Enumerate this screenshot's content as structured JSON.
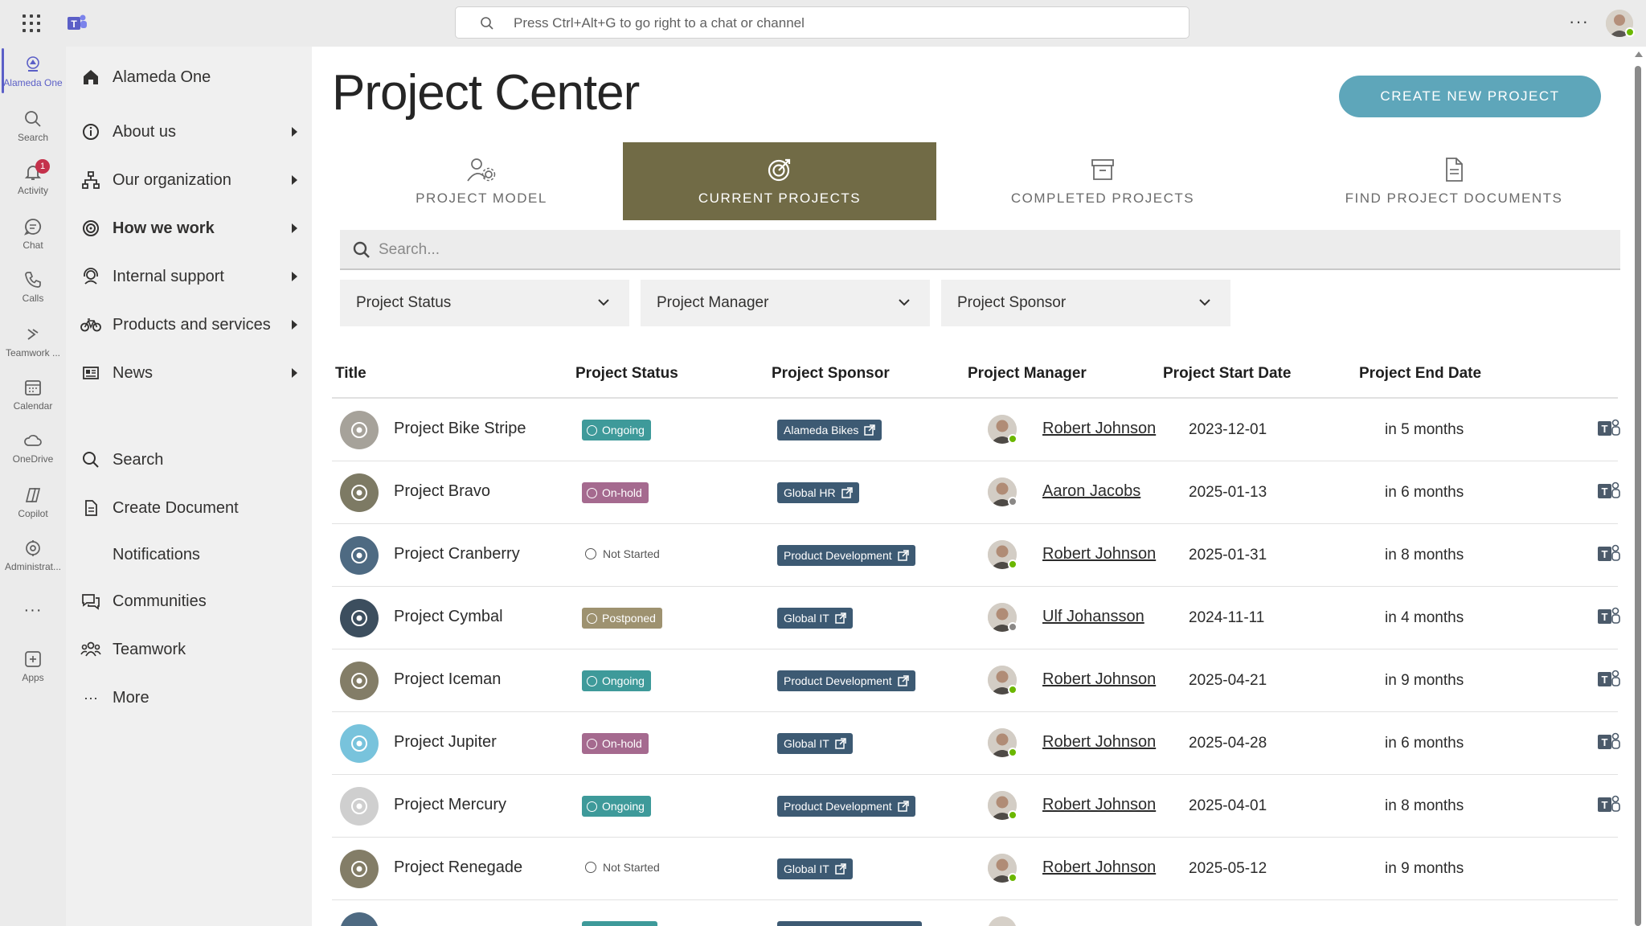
{
  "topbar": {
    "search_placeholder": "Press Ctrl+Alt+G to go right to a chat or channel",
    "more_label": "···"
  },
  "rail": {
    "items": [
      {
        "label": "Alameda One",
        "icon": "alameda-logo-icon",
        "active": true
      },
      {
        "label": "Search",
        "icon": "search-icon"
      },
      {
        "label": "Activity",
        "icon": "bell-icon",
        "badge": "1"
      },
      {
        "label": "Chat",
        "icon": "chat-icon"
      },
      {
        "label": "Calls",
        "icon": "phone-icon"
      },
      {
        "label": "Teamwork ...",
        "icon": "teamwork-icon"
      },
      {
        "label": "Calendar",
        "icon": "calendar-icon"
      },
      {
        "label": "OneDrive",
        "icon": "cloud-icon"
      },
      {
        "label": "Copilot",
        "icon": "copilot-icon"
      },
      {
        "label": "Administrat...",
        "icon": "admin-icon"
      },
      {
        "label": "···",
        "icon": "more-icon"
      },
      {
        "label": "Apps",
        "icon": "add-apps-icon"
      }
    ]
  },
  "sitenav": {
    "home": "Alameda One",
    "items": [
      {
        "label": "About us"
      },
      {
        "label": "Our organization"
      },
      {
        "label": "How we work"
      },
      {
        "label": "Internal support"
      },
      {
        "label": "Products and services"
      },
      {
        "label": "News"
      }
    ],
    "links": [
      {
        "label": "Search"
      },
      {
        "label": "Create Document"
      },
      {
        "label": "Notifications"
      },
      {
        "label": "Communities"
      },
      {
        "label": "Teamwork"
      },
      {
        "label": "More"
      }
    ]
  },
  "main": {
    "title": "Project Center",
    "create_button": "CREATE NEW PROJECT",
    "tabs": [
      {
        "label": "PROJECT MODEL"
      },
      {
        "label": "CURRENT PROJECTS",
        "active": true
      },
      {
        "label": "COMPLETED PROJECTS"
      },
      {
        "label": "FIND PROJECT DOCUMENTS"
      }
    ],
    "search_placeholder": "Search...",
    "filters": [
      {
        "label": "Project Status"
      },
      {
        "label": "Project Manager"
      },
      {
        "label": "Project Sponsor"
      }
    ],
    "columns": [
      "Title",
      "Project Status",
      "Project Sponsor",
      "Project Manager",
      "Project Start Date",
      "Project End Date"
    ],
    "rows": [
      {
        "title": "Project Bike Stripe",
        "status": "Ongoing",
        "status_kind": "ongoing",
        "sponsor": "Alameda Bikes",
        "manager": "Robert Johnson",
        "presence": "available",
        "start": "2023-12-01",
        "end": "in 5 months",
        "teams": true,
        "icon_color": "#a6a29a"
      },
      {
        "title": "Project Bravo",
        "status": "On-hold",
        "status_kind": "onhold",
        "sponsor": "Global HR",
        "manager": "Aaron Jacobs",
        "presence": "offline",
        "start": "2025-01-13",
        "end": "in 6 months",
        "teams": true,
        "icon_color": "#7d7a64"
      },
      {
        "title": "Project Cranberry",
        "status": "Not Started",
        "status_kind": "notstarted",
        "sponsor": "Product Development",
        "manager": "Robert Johnson",
        "presence": "available",
        "start": "2025-01-31",
        "end": "in 8 months",
        "teams": true,
        "icon_color": "#4e6a82"
      },
      {
        "title": "Project Cymbal",
        "status": "Postponed",
        "status_kind": "postponed",
        "sponsor": "Global IT",
        "manager": "Ulf Johansson",
        "presence": "offline",
        "start": "2024-11-11",
        "end": "in 4 months",
        "teams": true,
        "icon_color": "#3c4e5e"
      },
      {
        "title": "Project Iceman",
        "status": "Ongoing",
        "status_kind": "ongoing",
        "sponsor": "Product Development",
        "manager": "Robert Johnson",
        "presence": "available",
        "start": "2025-04-21",
        "end": "in 9 months",
        "teams": true,
        "icon_color": "#837d67"
      },
      {
        "title": "Project Jupiter",
        "status": "On-hold",
        "status_kind": "onhold",
        "sponsor": "Global IT",
        "manager": "Robert Johnson",
        "presence": "available",
        "start": "2025-04-28",
        "end": "in 6 months",
        "teams": true,
        "icon_color": "#78c3dc"
      },
      {
        "title": "Project Mercury",
        "status": "Ongoing",
        "status_kind": "ongoing",
        "sponsor": "Product Development",
        "manager": "Robert Johnson",
        "presence": "available",
        "start": "2025-04-01",
        "end": "in 8 months",
        "teams": true,
        "icon_color": "#cfcfcf"
      },
      {
        "title": "Project Renegade",
        "status": "Not Started",
        "status_kind": "notstarted",
        "sponsor": "Global IT",
        "manager": "Robert Johnson",
        "presence": "available",
        "start": "2025-05-12",
        "end": "in 9 months",
        "teams": false,
        "icon_color": "#837d67"
      }
    ]
  },
  "colors": {
    "accent_button": "#5ea6ba",
    "active_tab": "#716b46",
    "ongoing": "#3e9a9a",
    "onhold": "#a56a8f",
    "postponed": "#9e9270",
    "sponsor": "#3d5a73",
    "teams_purple": "#5b5fc7"
  }
}
